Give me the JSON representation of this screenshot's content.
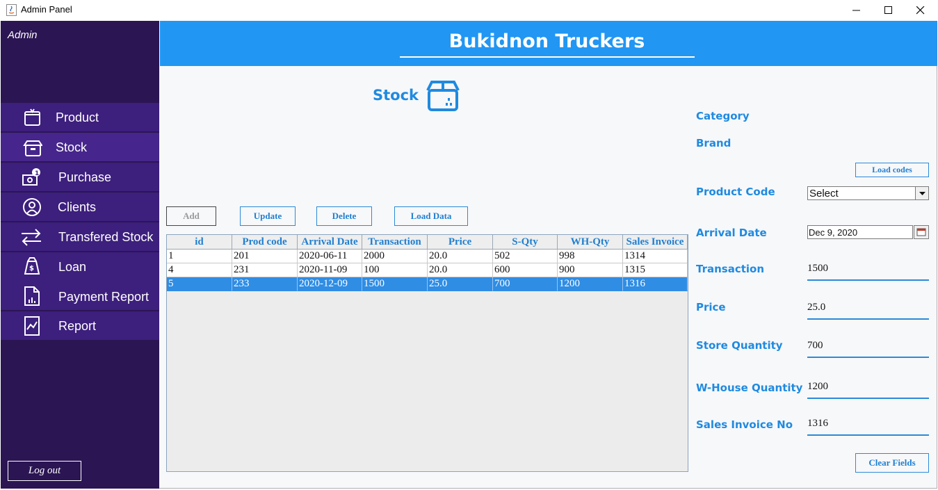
{
  "window": {
    "title": "Admin Panel"
  },
  "sidebar": {
    "user_label": "Admin",
    "items": [
      {
        "label": "Product",
        "icon": "product-icon"
      },
      {
        "label": "Stock",
        "icon": "stock-box-icon"
      },
      {
        "label": "Purchase",
        "icon": "purchase-icon"
      },
      {
        "label": "Clients",
        "icon": "clients-icon"
      },
      {
        "label": "Transfered Stock",
        "icon": "transfer-arrows-icon"
      },
      {
        "label": "Loan",
        "icon": "loan-bag-icon"
      },
      {
        "label": "Payment Report",
        "icon": "payment-report-icon"
      },
      {
        "label": "Report",
        "icon": "report-chart-icon"
      }
    ],
    "logout_label": "Log out"
  },
  "header": {
    "title": "Bukidnon Truckers"
  },
  "page": {
    "heading": "Stock"
  },
  "actions": {
    "add": "Add",
    "update": "Update",
    "delete": "Delete",
    "load_data": "Load Data",
    "load_codes": "Load codes",
    "clear_fields": "Clear Fields"
  },
  "table": {
    "columns": [
      "id",
      "Prod code",
      "Arrival Date",
      "Transaction",
      "Price",
      "S-Qty",
      "WH-Qty",
      "Sales Invoice"
    ],
    "rows": [
      [
        "1",
        "201",
        "2020-06-11",
        "2000",
        "20.0",
        "502",
        "998",
        "1314"
      ],
      [
        "4",
        "231",
        "2020-11-09",
        "100",
        "20.0",
        "600",
        "900",
        "1315"
      ],
      [
        "5",
        "233",
        "2020-12-09",
        "1500",
        "25.0",
        "700",
        "1200",
        "1316"
      ]
    ],
    "selected_row": 2
  },
  "form": {
    "category_label": "Category",
    "brand_label": "Brand",
    "product_code_label": "Product Code",
    "product_code_value": "Select",
    "arrival_date_label": "Arrival Date",
    "arrival_date_value": "Dec 9, 2020",
    "transaction_label": "Transaction",
    "transaction_value": "1500",
    "price_label": "Price",
    "price_value": "25.0",
    "store_qty_label": "Store Quantity",
    "store_qty_value": "700",
    "wh_qty_label": "W-House Quantity",
    "wh_qty_value": "1200",
    "sales_invoice_label": "Sales Invoice No",
    "sales_invoice_value": "1316"
  },
  "colors": {
    "sidebar_bg": "#2b1553",
    "nav_item_bg": "#3d1f7d",
    "header_bg": "#2196f3",
    "accent_text": "#1f8ae0",
    "selected_row": "#2f8de4"
  }
}
